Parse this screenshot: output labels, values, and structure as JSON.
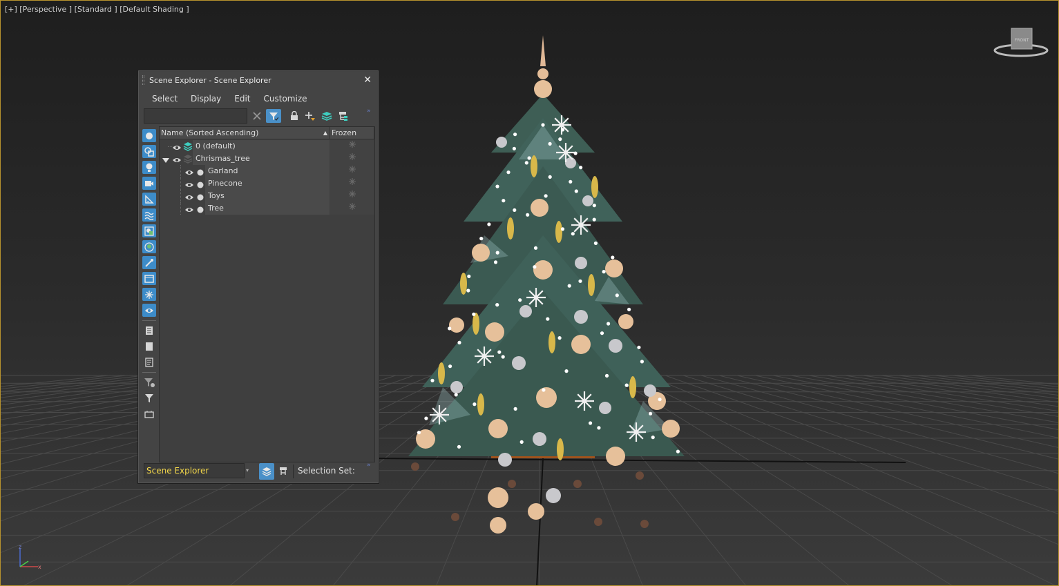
{
  "viewport": {
    "label": "[+] [Perspective ] [Standard ] [Default Shading ]",
    "viewcube_label": "FRONT",
    "axis_z": "z",
    "axis_x": "x",
    "colors": {
      "border": "#b8932e",
      "grid": "#4a4a4a",
      "tree": "#3d5f55"
    }
  },
  "scene_explorer": {
    "title": "Scene Explorer - Scene Explorer",
    "close_icon": "✕",
    "menu": [
      "Select",
      "Display",
      "Edit",
      "Customize"
    ],
    "search": {
      "value": "",
      "placeholder": ""
    },
    "columns": {
      "name": "Name (Sorted Ascending)",
      "sort_indicator": "▲",
      "frozen": "Frozen"
    },
    "rows": [
      {
        "label": "0 (default)",
        "type": "layer",
        "depth": 0,
        "expanded": false,
        "shaded": true
      },
      {
        "label": "Chrismas_tree",
        "type": "layer",
        "depth": 0,
        "expanded": true,
        "shaded": true
      },
      {
        "label": "Garland",
        "type": "object",
        "depth": 1,
        "shaded": true
      },
      {
        "label": "Pinecone",
        "type": "object",
        "depth": 1,
        "shaded": true
      },
      {
        "label": "Toys",
        "type": "object",
        "depth": 1,
        "shaded": true
      },
      {
        "label": "Tree",
        "type": "object",
        "depth": 1,
        "shaded": true
      }
    ],
    "explorer_dropdown": "Scene Explorer",
    "selection_set_label": "Selection Set:",
    "colors": {
      "accent": "#3d8cc9",
      "dropdown_text": "#f4d84a"
    }
  }
}
